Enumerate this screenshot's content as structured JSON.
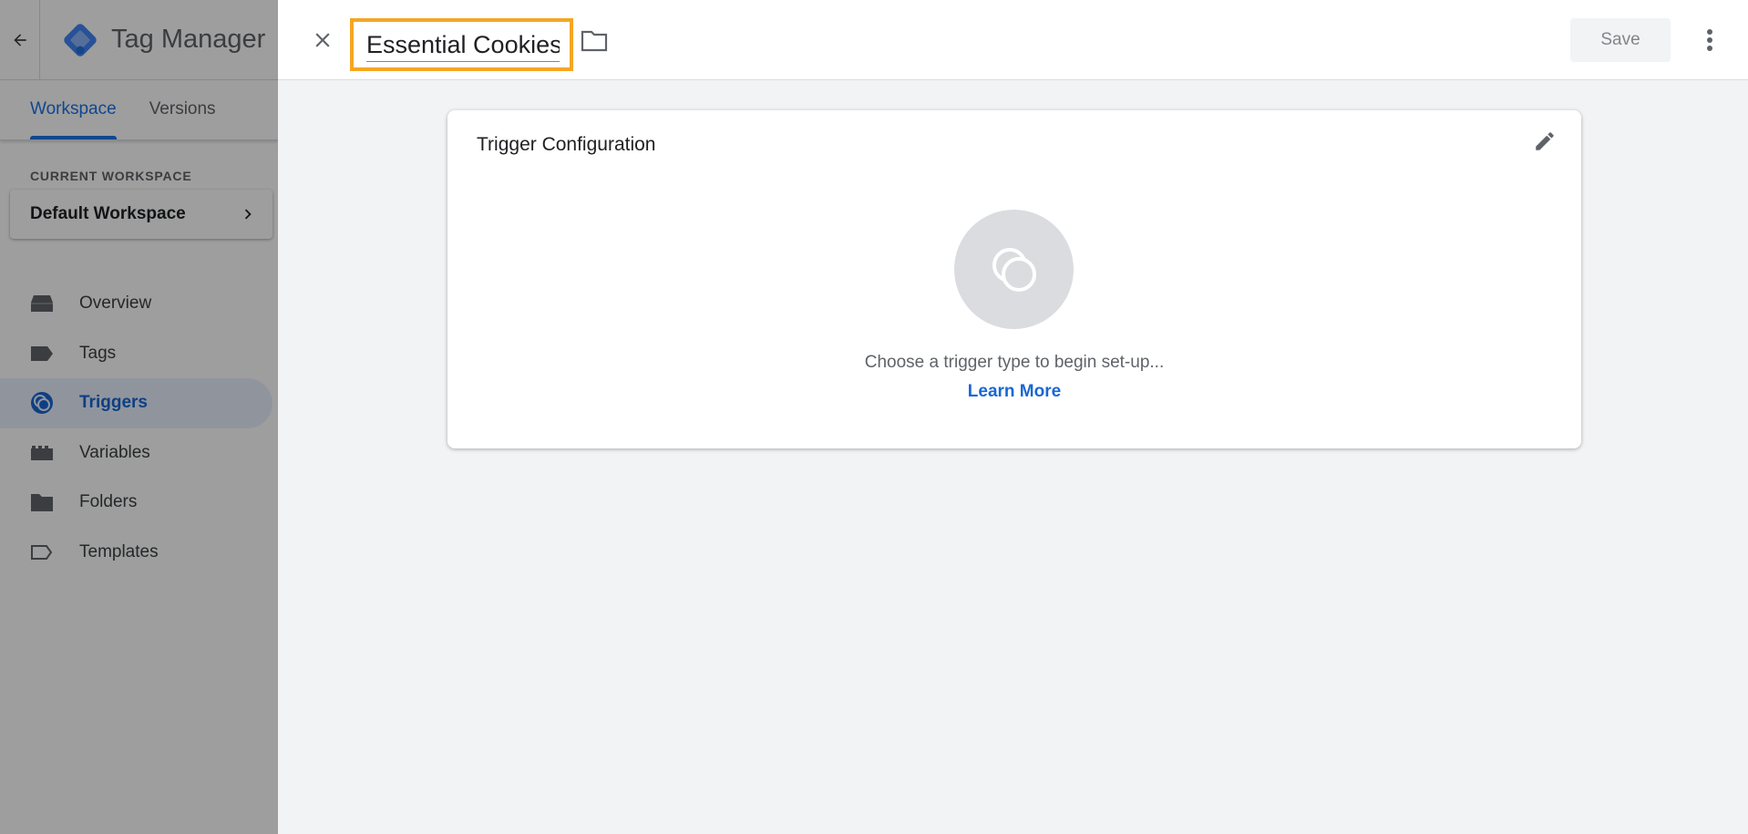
{
  "app": {
    "title": "Tag Manager"
  },
  "sidebar": {
    "tabs": [
      {
        "label": "Workspace",
        "active": true
      },
      {
        "label": "Versions",
        "active": false
      }
    ],
    "current_workspace_label": "CURRENT WORKSPACE",
    "workspace_name": "Default Workspace",
    "items": [
      {
        "label": "Overview",
        "icon": "overview-icon"
      },
      {
        "label": "Tags",
        "icon": "tag-icon"
      },
      {
        "label": "Triggers",
        "icon": "trigger-icon",
        "active": true
      },
      {
        "label": "Variables",
        "icon": "variables-icon"
      },
      {
        "label": "Folders",
        "icon": "folder-icon"
      },
      {
        "label": "Templates",
        "icon": "template-icon"
      }
    ]
  },
  "editor": {
    "name_value": "Essential Cookies",
    "save_label": "Save",
    "card_title": "Trigger Configuration",
    "prompt": "Choose a trigger type to begin set-up...",
    "learn_more": "Learn More"
  },
  "colors": {
    "accent": "#1a73e8",
    "highlight_border": "#f5a623",
    "logo": "#4285f4"
  }
}
